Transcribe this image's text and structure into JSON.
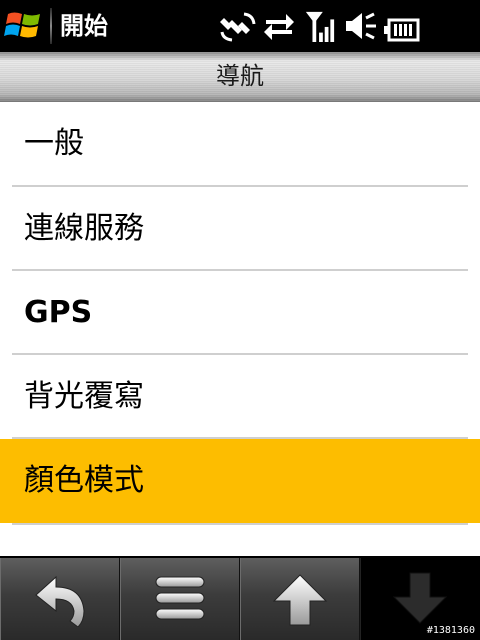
{
  "status_bar": {
    "start_label": "開始",
    "icons": [
      "windows-logo",
      "satellite-icon",
      "data-transfer-icon",
      "signal-strength-icon",
      "volume-icon",
      "battery-icon"
    ]
  },
  "title_bar": {
    "title": "導航"
  },
  "menu": {
    "items": [
      {
        "label": "一般",
        "selected": false
      },
      {
        "label": "連線服務",
        "selected": false
      },
      {
        "label": "GPS",
        "selected": false
      },
      {
        "label": "背光覆寫",
        "selected": false
      },
      {
        "label": "顏色模式",
        "selected": true
      }
    ]
  },
  "toolbar": {
    "buttons": [
      "back-icon",
      "menu-icon",
      "scroll-up-icon",
      "scroll-down-icon"
    ]
  },
  "watermark": "#1381360",
  "colors": {
    "selected_item": "#fdbd00",
    "status_bar": "#000000"
  }
}
